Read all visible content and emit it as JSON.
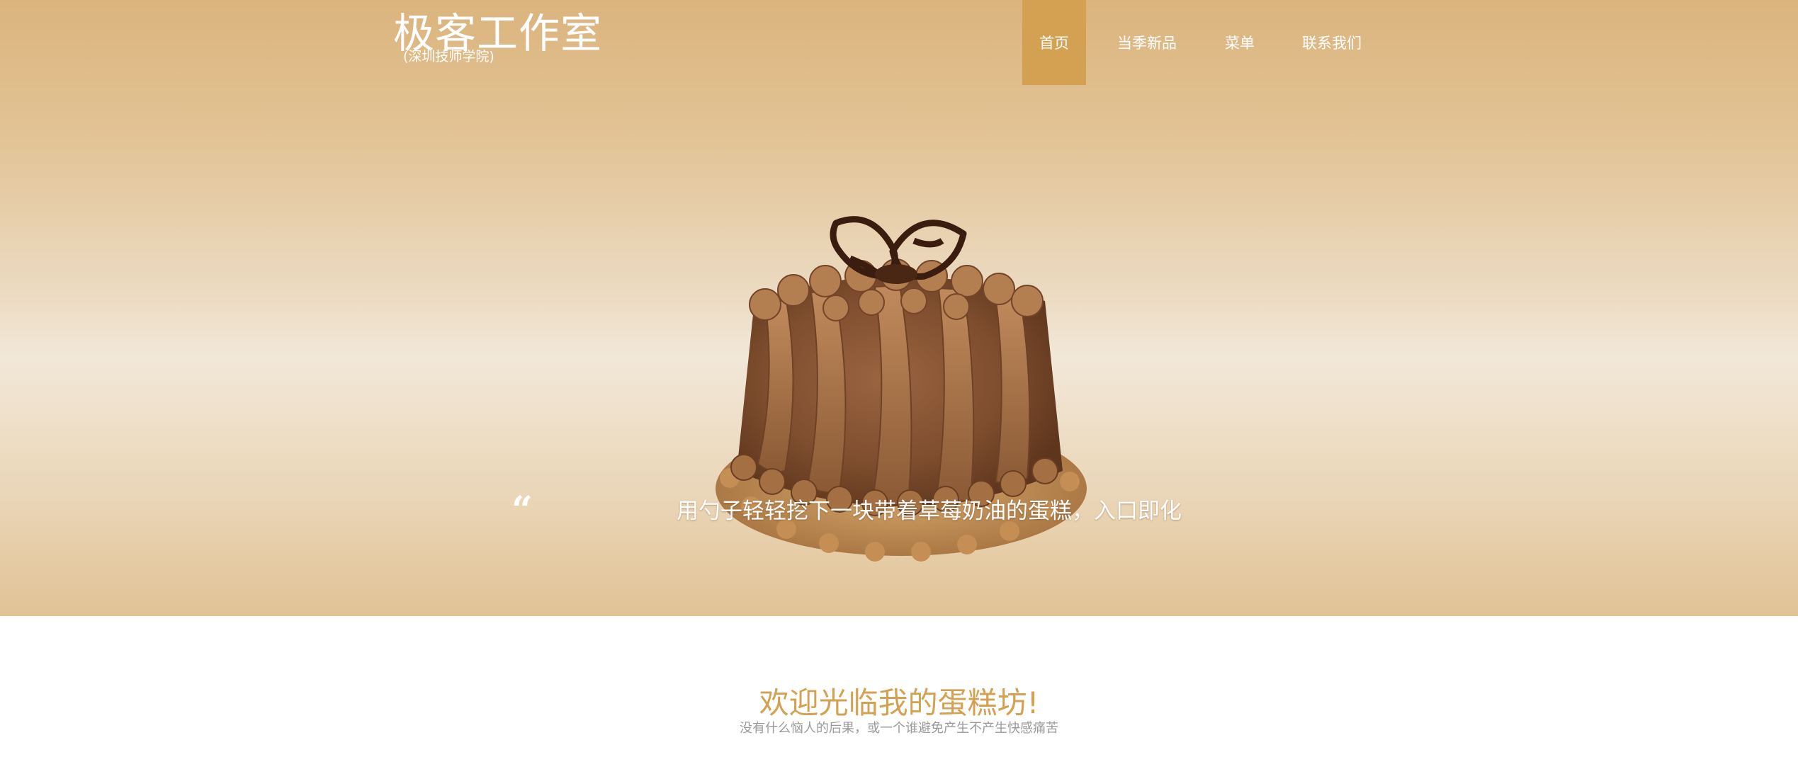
{
  "header": {
    "brand_title": "极客工作室",
    "brand_subtitle": "(深圳技师学院)",
    "nav": [
      {
        "label": "首页",
        "active": true
      },
      {
        "label": "当季新品",
        "active": false
      },
      {
        "label": "菜单",
        "active": false
      },
      {
        "label": "联系我们",
        "active": false
      }
    ]
  },
  "hero": {
    "image": "chocolate-cake-image",
    "quote_icon": "“",
    "quote_text": "用勺子轻轻挖下一块带着草莓奶油的蛋糕，入口即化"
  },
  "welcome": {
    "title": "欢迎光临我的蛋糕坊!",
    "subtitle": "没有什么恼人的后果，或一个谁避免产生不产生快感痛苦"
  },
  "colors": {
    "accent": "#d4a152",
    "hero_top": "#dbb47d",
    "hero_mid": "#f2e8d8",
    "text_muted": "#9a9a9a"
  }
}
